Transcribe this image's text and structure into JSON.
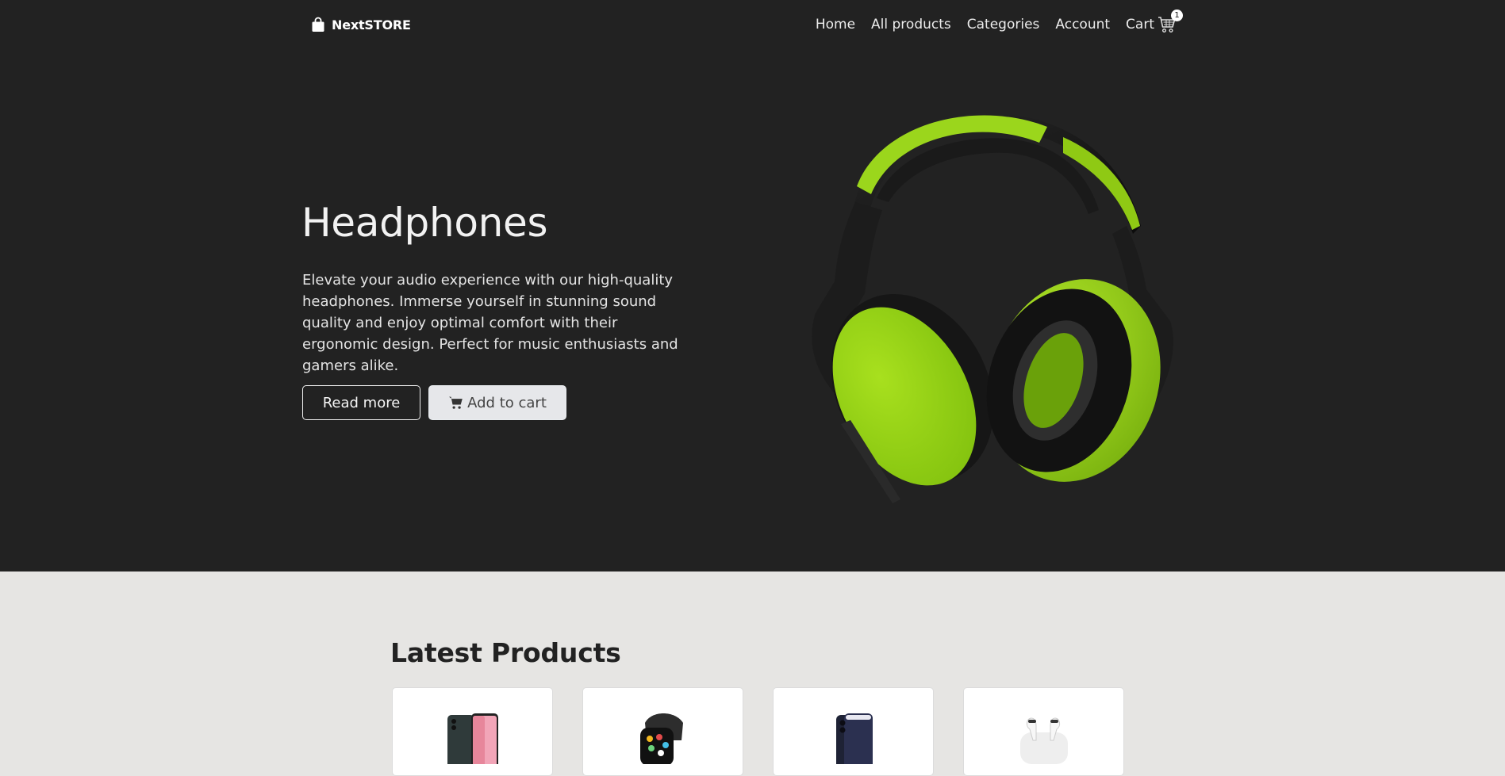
{
  "header": {
    "brand": "NextSTORE",
    "brand_icon": "shopping-bag-icon",
    "nav": [
      {
        "label": "Home"
      },
      {
        "label": "All products"
      },
      {
        "label": "Categories"
      },
      {
        "label": "Account"
      }
    ],
    "cart": {
      "label": "Cart",
      "count": "1",
      "icon": "shopping-cart-icon"
    }
  },
  "hero": {
    "title": "Headphones",
    "description": "Elevate your audio experience with our high-quality headphones. Immerse yourself in stunning sound quality and enjoy optimal comfort with their ergonomic design. Perfect for music enthusiasts and gamers alike.",
    "read_more_label": "Read more",
    "add_to_cart_label": "Add to cart",
    "image": "green-black-headphones",
    "accent_color": "#8fd01a"
  },
  "latest": {
    "title": "Latest Products",
    "products": [
      {
        "image": "android-smartphone"
      },
      {
        "image": "smartwatch"
      },
      {
        "image": "iphone"
      },
      {
        "image": "airpods-pro"
      }
    ]
  },
  "colors": {
    "hero_bg": "#222222",
    "page_bg": "#e6e5e3",
    "button_light": "#e6e7ea"
  }
}
